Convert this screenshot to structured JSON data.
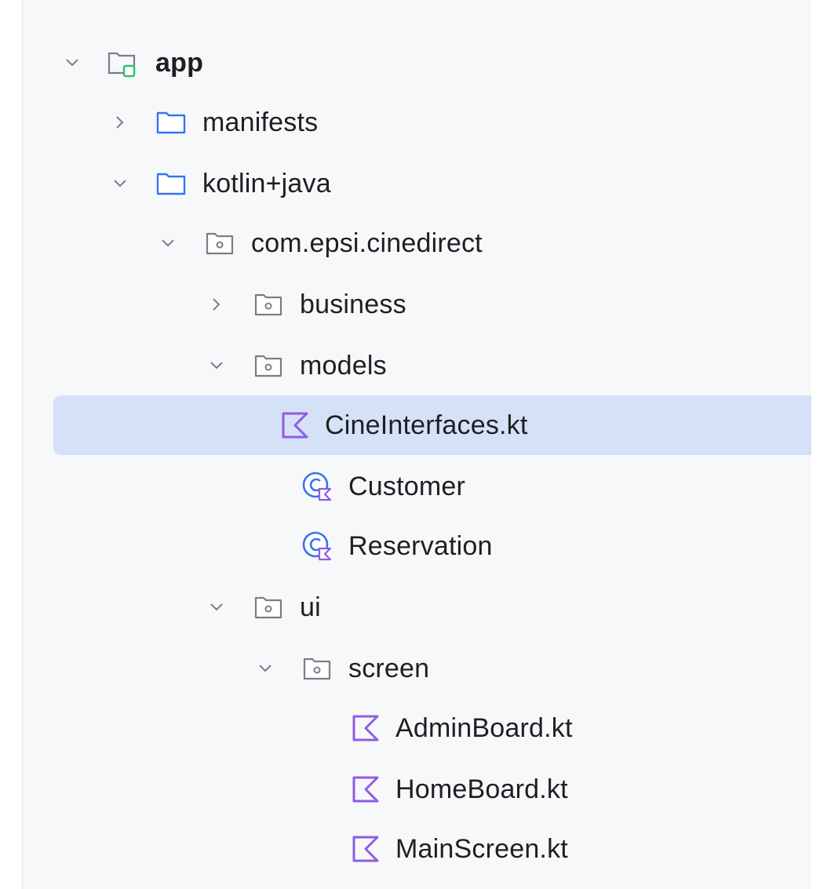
{
  "tree": {
    "root": {
      "label": "app",
      "expanded": true,
      "icon": "module-folder-icon"
    },
    "manifests": {
      "label": "manifests",
      "expanded": false,
      "icon": "folder-icon"
    },
    "kotlin_java": {
      "label": "kotlin+java",
      "expanded": true,
      "icon": "folder-icon"
    },
    "package": {
      "label": "com.epsi.cinedirect",
      "expanded": true,
      "icon": "package-icon"
    },
    "business": {
      "label": "business",
      "expanded": false,
      "icon": "package-icon"
    },
    "models": {
      "label": "models",
      "expanded": true,
      "icon": "package-icon"
    },
    "cineinterfaces": {
      "label": "CineInterfaces.kt",
      "selected": true,
      "icon": "kotlin-file-icon"
    },
    "customer": {
      "label": "Customer",
      "icon": "kotlin-class-icon"
    },
    "reservation": {
      "label": "Reservation",
      "icon": "kotlin-class-icon"
    },
    "ui": {
      "label": "ui",
      "expanded": true,
      "icon": "package-icon"
    },
    "screen": {
      "label": "screen",
      "expanded": true,
      "icon": "package-icon"
    },
    "adminboard": {
      "label": "AdminBoard.kt",
      "icon": "kotlin-file-icon"
    },
    "homeboard": {
      "label": "HomeBoard.kt",
      "icon": "kotlin-file-icon"
    },
    "mainscreen": {
      "label": "MainScreen.kt",
      "icon": "kotlin-file-icon"
    }
  },
  "colors": {
    "selection": "#d5e1f7",
    "folder_stroke": "#3574f0",
    "kotlin_purple": "#8f5ce6",
    "class_blue": "#3574f0",
    "module_green": "#2fbf71",
    "text": "#1e1f22"
  }
}
